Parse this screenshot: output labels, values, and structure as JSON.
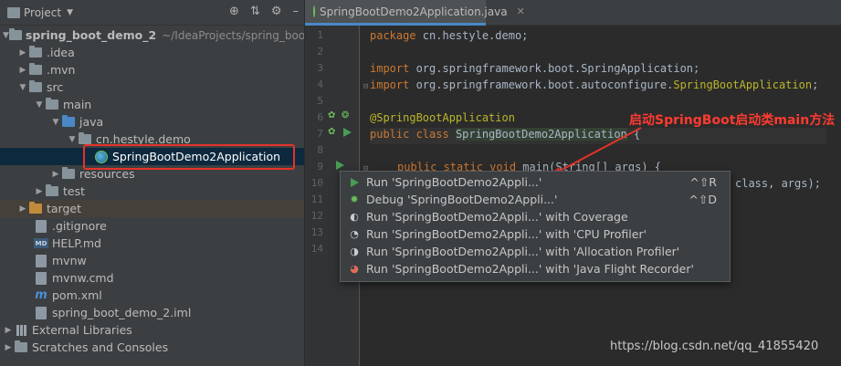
{
  "project_panel": {
    "title": "Project",
    "tree": [
      {
        "label": "spring_boot_demo_2",
        "hint": "~/IdeaProjects/spring_boo"
      },
      {
        "label": ".idea"
      },
      {
        "label": ".mvn"
      },
      {
        "label": "src"
      },
      {
        "label": "main"
      },
      {
        "label": "java"
      },
      {
        "label": "cn.hestyle.demo"
      },
      {
        "label": "SpringBootDemo2Application"
      },
      {
        "label": "resources"
      },
      {
        "label": "test"
      },
      {
        "label": "target"
      },
      {
        "label": ".gitignore"
      },
      {
        "label": "HELP.md"
      },
      {
        "label": "mvnw"
      },
      {
        "label": "mvnw.cmd"
      },
      {
        "label": "pom.xml"
      },
      {
        "label": "spring_boot_demo_2.iml"
      },
      {
        "label": "External Libraries"
      },
      {
        "label": "Scratches and Consoles"
      }
    ]
  },
  "editor": {
    "tab_label": "SpringBootDemo2Application.java",
    "line_numbers": [
      "1",
      "2",
      "3",
      "4",
      "5",
      "6",
      "7",
      "8",
      "9",
      "10",
      "11",
      "12",
      "13",
      "14"
    ],
    "code": {
      "l1_kw": "package",
      "l1_rest": " cn.hestyle.demo;",
      "l3_kw": "import",
      "l3_rest": " org.springframework.boot.SpringApplication;",
      "l4_kw": "import",
      "l4_rest": " org.springframework.boot.autoconfigure.",
      "l4_ann": "SpringBootApplication",
      "l4_end": ";",
      "l6_ann": "@SpringBootApplication",
      "l7_kw": "public class",
      "l7_cls": "SpringBootDemo2Application",
      "l7_rest": " {",
      "l9_kw": "public static void",
      "l9_rest": " main(String[] args) {",
      "l10_rest": "class, args);"
    }
  },
  "annotation_text": "启动SpringBoot启动类main方法",
  "popup": {
    "items": [
      {
        "label": "Run 'SpringBootDemo2Appli...'",
        "shortcut": "^⇧R",
        "icon": "run-icon"
      },
      {
        "label": "Debug 'SpringBootDemo2Appli...'",
        "shortcut": "^⇧D",
        "icon": "debug-icon"
      },
      {
        "label": "Run 'SpringBootDemo2Appli...' with Coverage",
        "icon": "coverage-icon"
      },
      {
        "label": "Run 'SpringBootDemo2Appli...' with 'CPU Profiler'",
        "icon": "cpu-profiler-icon"
      },
      {
        "label": "Run 'SpringBootDemo2Appli...' with 'Allocation Profiler'",
        "icon": "allocation-profiler-icon"
      },
      {
        "label": "Run 'SpringBootDemo2Appli...' with 'Java Flight Recorder'",
        "icon": "flight-recorder-icon"
      }
    ]
  },
  "watermark": "https://blog.csdn.net/qq_41855420",
  "colors": {
    "accent": "#4a88c7",
    "annotation": "#ff3b30",
    "keyword": "#cc7832",
    "annotation_code": "#bbb529"
  }
}
